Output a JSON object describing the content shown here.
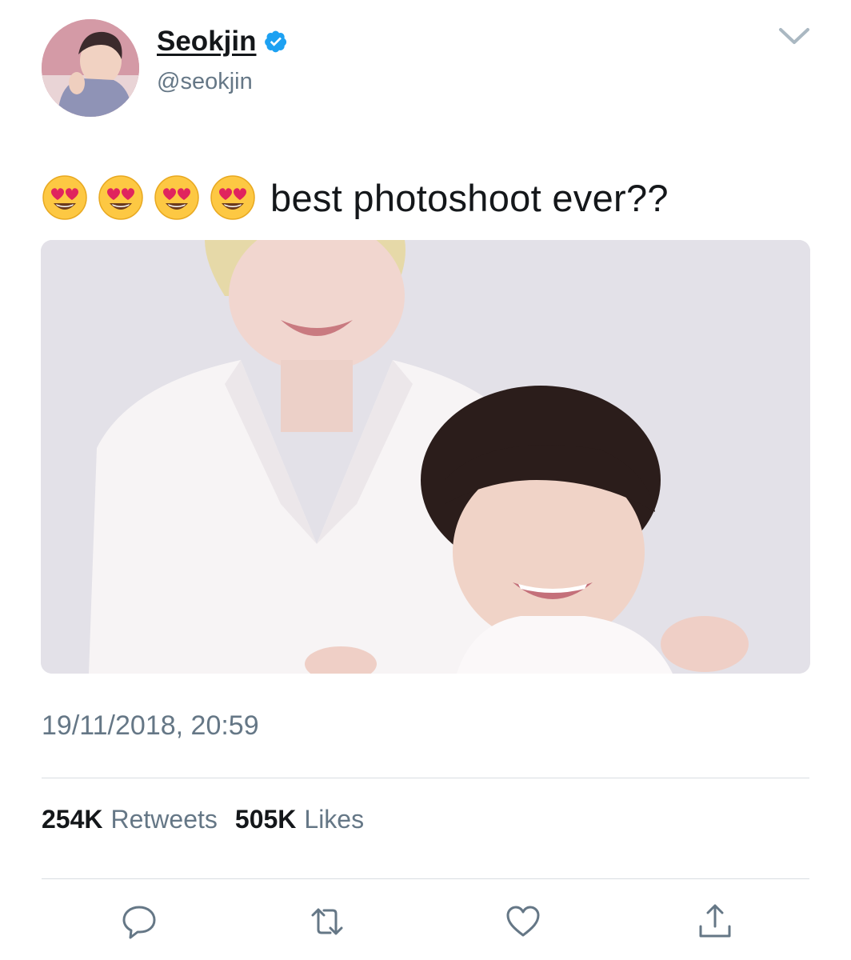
{
  "author": {
    "display_name": "Seokjin",
    "handle": "@seokjin",
    "verified": true,
    "verified_color": "#1da1f2"
  },
  "tweet": {
    "emojis": [
      "smiling-face-with-heart-eyes",
      "smiling-face-with-heart-eyes",
      "smiling-face-with-heart-eyes",
      "smiling-face-with-heart-eyes"
    ],
    "text": "best photoshoot ever??",
    "timestamp": "19/11/2018, 20:59"
  },
  "stats": {
    "retweets_count": "254K",
    "retweets_label": "Retweets",
    "likes_count": "505K",
    "likes_label": "Likes"
  },
  "actions": [
    "reply-icon",
    "retweet-icon",
    "like-icon",
    "share-icon"
  ],
  "colors": {
    "text_primary": "#14171a",
    "text_secondary": "#657786",
    "divider": "#d8dde2",
    "action_icon": "#657786"
  }
}
